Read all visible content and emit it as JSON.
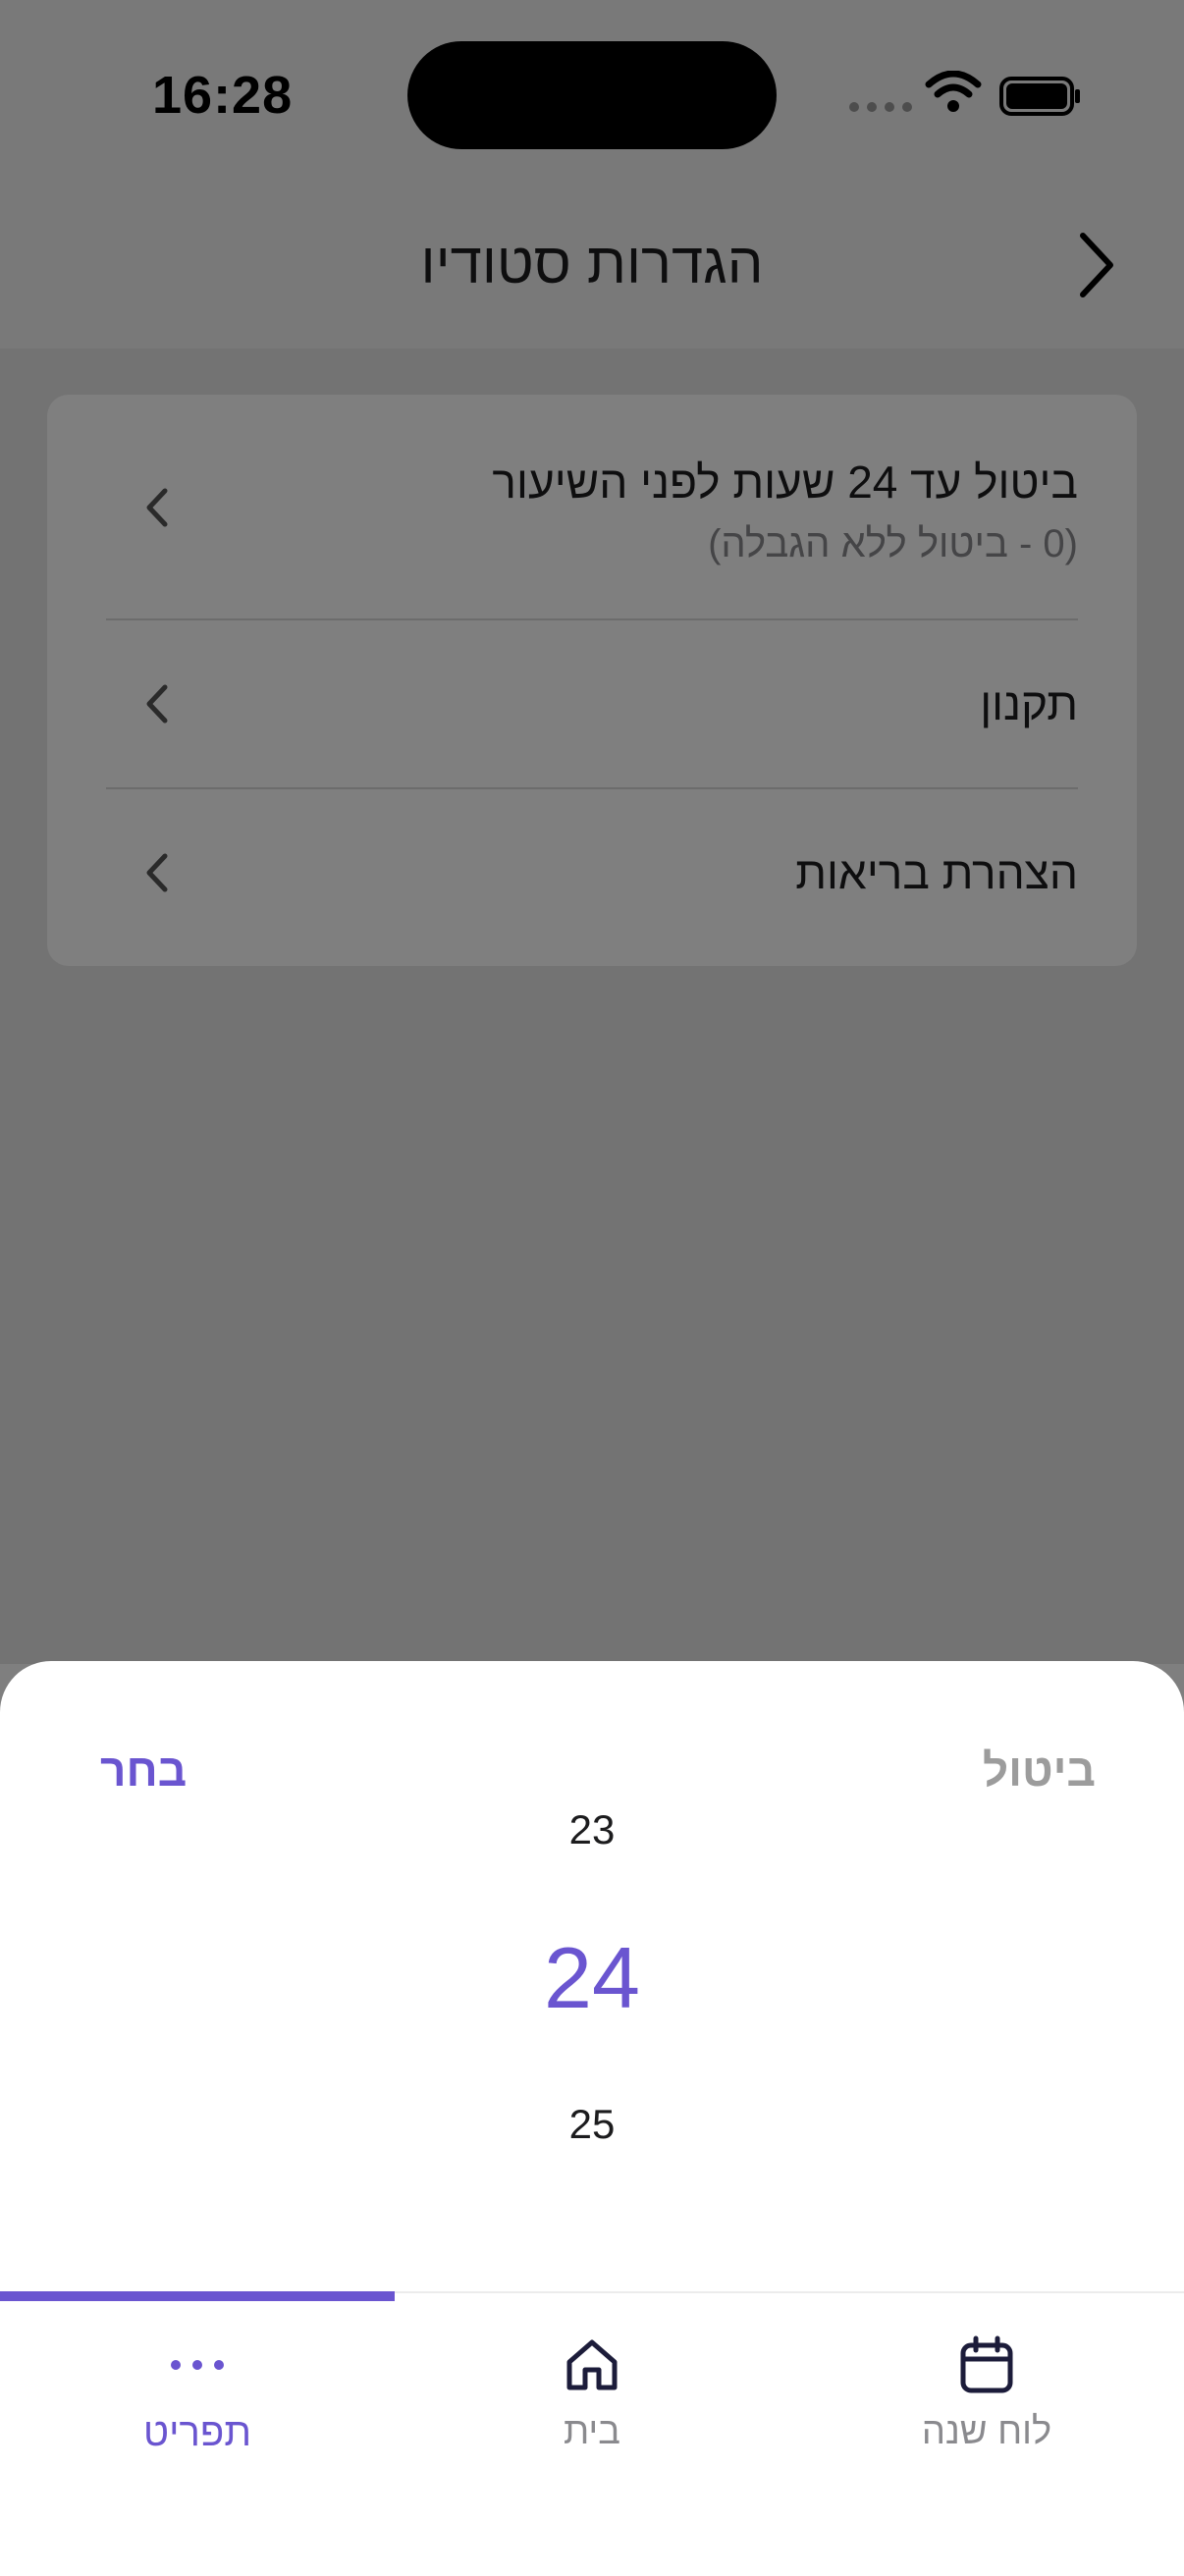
{
  "status_bar": {
    "time": "16:28"
  },
  "header": {
    "title": "הגדרות סטודיו"
  },
  "settings": {
    "items": [
      {
        "label": "ביטול עד 24 שעות לפני השיעור",
        "sublabel": "(0 - ביטול ללא הגבלה)"
      },
      {
        "label": "תקנון"
      },
      {
        "label": "הצהרת בריאות"
      }
    ]
  },
  "picker": {
    "cancel_label": "ביטול",
    "select_label": "בחר",
    "values": [
      "23",
      "24",
      "25"
    ],
    "selected": "24"
  },
  "tabbar": {
    "tabs": [
      {
        "label": "תפריט",
        "icon": "more-dots-icon",
        "active": true
      },
      {
        "label": "בית",
        "icon": "home-icon",
        "active": false
      },
      {
        "label": "לוח שנה",
        "icon": "calendar-icon",
        "active": false
      }
    ]
  },
  "colors": {
    "accent": "#6a55d0",
    "overlay": "rgba(0,0,0,0.5)"
  }
}
